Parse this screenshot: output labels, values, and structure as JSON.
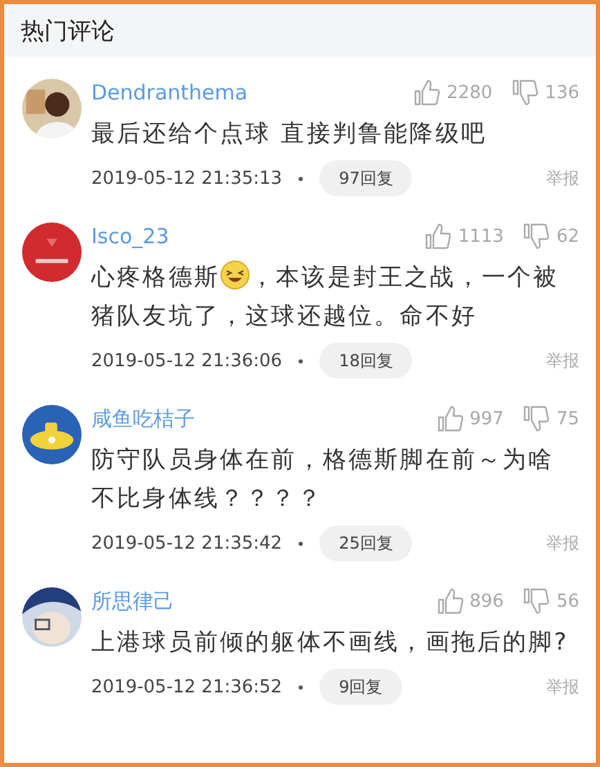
{
  "header": {
    "title": "热门评论"
  },
  "comments": [
    {
      "username": "Dendranthema",
      "likes": "2280",
      "dislikes": "136",
      "body": [
        {
          "kind": "text",
          "text": "最后还给个点球 直接判鲁能降级吧"
        }
      ],
      "time": "2019-05-12 21:35:13",
      "replies": "97回复",
      "report": "举报"
    },
    {
      "username": "Isco_23",
      "likes": "1113",
      "dislikes": "62",
      "body": [
        {
          "kind": "text",
          "text": "心疼格德斯"
        },
        {
          "kind": "emoji"
        },
        {
          "kind": "text",
          "text": "，本该是封王之战，一个被"
        },
        {
          "kind": "break"
        },
        {
          "kind": "text",
          "text": "猪队友坑了，这球还越位。命不好"
        }
      ],
      "time": "2019-05-12 21:36:06",
      "replies": "18回复",
      "report": "举报"
    },
    {
      "username": "咸鱼吃桔子",
      "likes": "997",
      "dislikes": "75",
      "body": [
        {
          "kind": "text",
          "text": "防守队员身体在前，格德斯脚在前～为啥不比身体线？？？？"
        }
      ],
      "time": "2019-05-12 21:35:42",
      "replies": "25回复",
      "report": "举报"
    },
    {
      "username": "所思律己",
      "likes": "896",
      "dislikes": "56",
      "body": [
        {
          "kind": "text",
          "text": "上港球员前倾的躯体不画线，画拖后的脚?"
        }
      ],
      "time": "2019-05-12 21:36:52",
      "replies": "9回复",
      "report": "举报"
    }
  ]
}
